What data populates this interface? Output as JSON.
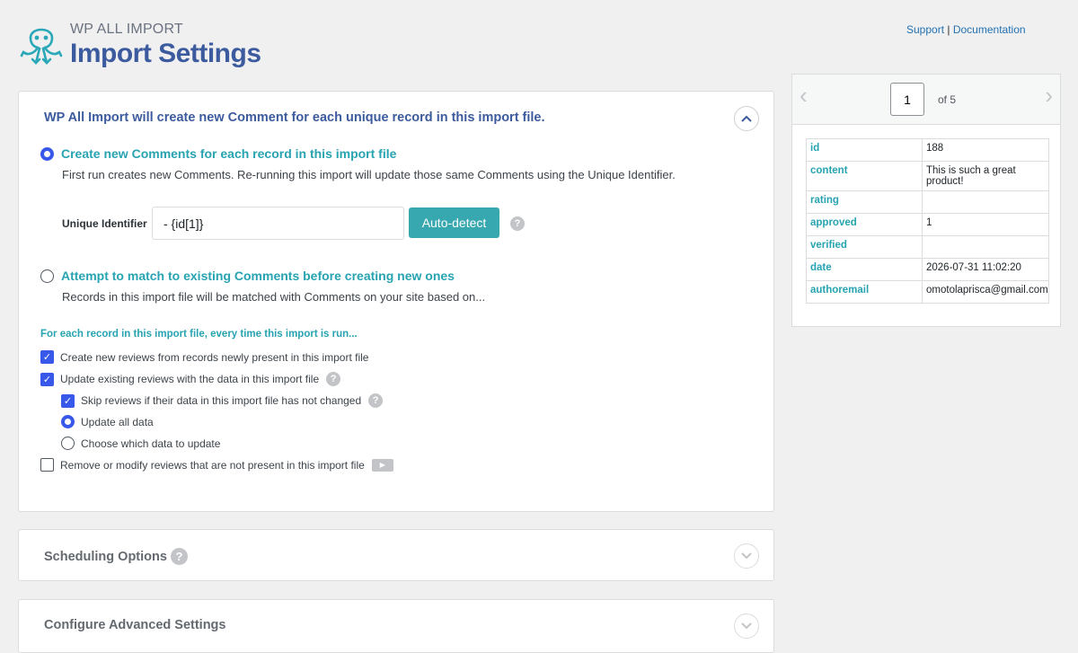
{
  "header": {
    "brand_sub": "WP ALL IMPORT",
    "title": "Import Settings",
    "support_link": "Support",
    "link_separator": "|",
    "documentation_link": "Documentation"
  },
  "main_panel": {
    "title": "WP All Import will create new Comment for each unique record in this import file.",
    "option_create": {
      "label": "Create new Comments for each record in this import file",
      "selected": true,
      "description": "First run creates new Comments. Re-running this import will update those same Comments using the Unique Identifier."
    },
    "unique_identifier": {
      "label": "Unique Identifier",
      "value": "- {id[1]}",
      "button": "Auto-detect"
    },
    "option_match": {
      "label": "Attempt to match to existing Comments before creating new ones",
      "selected": false,
      "description": "Records in this import file will be matched with Comments on your site based on..."
    },
    "section_hint": "For each record in this import file, every time this import is run...",
    "checks": {
      "create_new": "Create new reviews from records newly present in this import file",
      "update_existing": "Update existing reviews with the data in this import file",
      "skip_unchanged": "Skip reviews if their data in this import file has not changed",
      "update_all": "Update all data",
      "choose_data": "Choose which data to update",
      "remove_modify": "Remove or modify reviews that are not present in this import file"
    }
  },
  "scheduling": {
    "title": "Scheduling Options"
  },
  "advanced": {
    "title": "Configure Advanced Settings"
  },
  "preview": {
    "page": "1",
    "of_label": "of 5",
    "rows": [
      {
        "key": "id",
        "value": "188"
      },
      {
        "key": "content",
        "value": "This is such a great product!"
      },
      {
        "key": "rating",
        "value": ""
      },
      {
        "key": "approved",
        "value": "1"
      },
      {
        "key": "verified",
        "value": ""
      },
      {
        "key": "date",
        "value": "2026-07-31 11:02:20"
      },
      {
        "key": "authoremail",
        "value": "omotolaprisca@gmail.com"
      }
    ]
  },
  "colors": {
    "accent_blue": "#3858e9",
    "title_blue": "#3c5b9e",
    "teal": "#27a3b1",
    "button_teal": "#38a8b0"
  }
}
